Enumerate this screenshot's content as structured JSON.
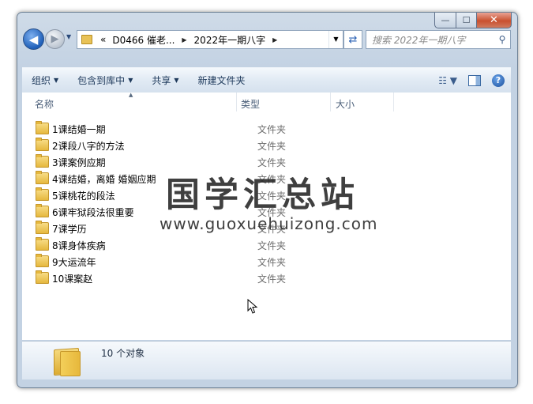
{
  "window": {
    "controls": {
      "minimize": "—",
      "maximize": "☐",
      "close": "✕"
    }
  },
  "nav": {
    "back_icon": "arrow-left-icon",
    "forward_icon": "arrow-right-icon",
    "breadcrumb": [
      "«",
      "D0466 催老...",
      "2022年一期八字"
    ],
    "search_placeholder": "搜索 2022年一期八字"
  },
  "toolbar": {
    "organize": "组织",
    "include_in_library": "包含到库中",
    "share": "共享",
    "new_folder": "新建文件夹"
  },
  "columns": {
    "name": "名称",
    "type": "类型",
    "size": "大小"
  },
  "files": [
    {
      "name": "1课结婚一期",
      "type": "文件夹"
    },
    {
      "name": "2课段八字的方法",
      "type": "文件夹"
    },
    {
      "name": "3课案例应期",
      "type": "文件夹"
    },
    {
      "name": "4课结婚，离婚  婚姻应期",
      "type": "文件夹"
    },
    {
      "name": "5课桃花的段法",
      "type": "文件夹"
    },
    {
      "name": "6课牢狱段法很重要",
      "type": "文件夹"
    },
    {
      "name": "7课学历",
      "type": "文件夹"
    },
    {
      "name": "8课身体疾病",
      "type": "文件夹"
    },
    {
      "name": "9大运流年",
      "type": "文件夹"
    },
    {
      "name": "10课案赵",
      "type": "文件夹"
    }
  ],
  "watermark": {
    "title": "国学汇总站",
    "url": "www.guoxuehuizong.com"
  },
  "details": {
    "count": "10 个对象"
  },
  "colors": {
    "accent": "#1e395b",
    "folder": "#e6b83e",
    "frame": "#c3d2e3"
  }
}
